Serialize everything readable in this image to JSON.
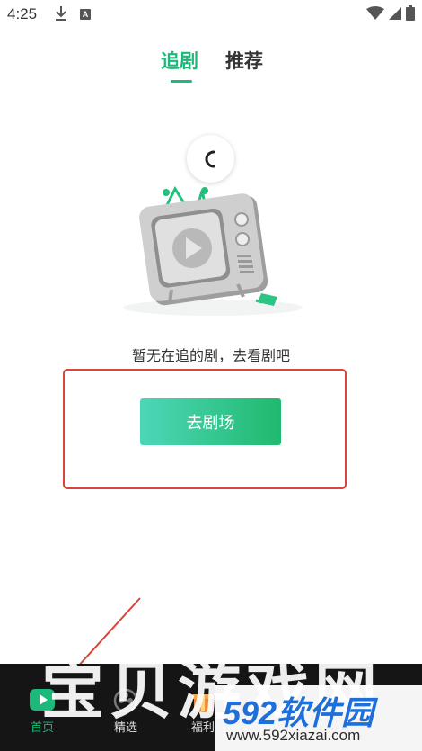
{
  "status_bar": {
    "time": "4:25",
    "a_badge": "A"
  },
  "tabs": [
    {
      "label": "追剧",
      "active": true
    },
    {
      "label": "推荐",
      "active": false
    }
  ],
  "empty_state": {
    "message": "暂无在追的剧，去看剧吧",
    "button_label": "去剧场"
  },
  "bottom_nav": [
    {
      "label": "首页",
      "icon": "home-play-icon",
      "active": true
    },
    {
      "label": "精选",
      "icon": "featured-icon",
      "active": false
    },
    {
      "label": "福利",
      "icon": "gift-icon",
      "active": false
    }
  ],
  "watermark": {
    "text": "宝贝游戏网",
    "brand": "592软件园",
    "url": "www.592xiazai.com"
  },
  "colors": {
    "accent": "#1db97a",
    "button_gradient_start": "#4cd7b8",
    "button_gradient_end": "#21b96e",
    "annotation_red": "#d9453a",
    "nav_background": "#151515"
  }
}
